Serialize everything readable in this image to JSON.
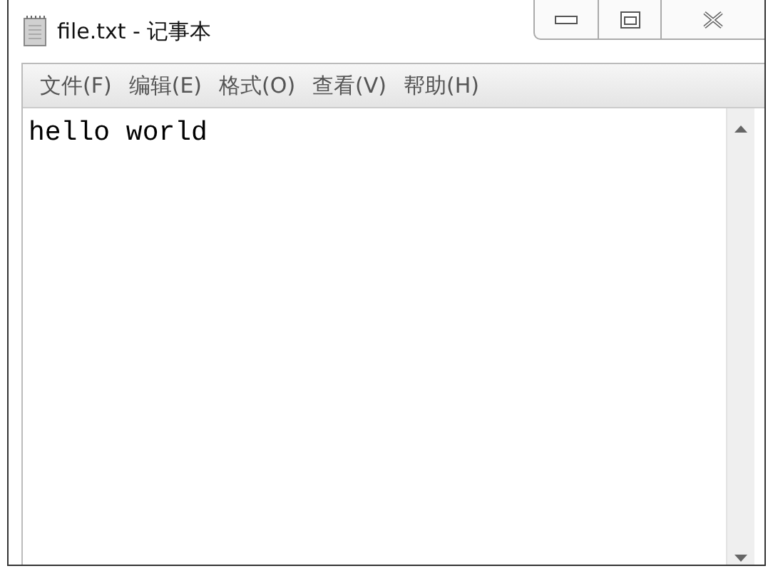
{
  "window": {
    "title": "file.txt - 记事本"
  },
  "menu": [
    {
      "label": "文件(F)"
    },
    {
      "label": "编辑(E)"
    },
    {
      "label": "格式(O)"
    },
    {
      "label": "查看(V)"
    },
    {
      "label": "帮助(H)"
    }
  ],
  "editor": {
    "text": "hello world"
  }
}
